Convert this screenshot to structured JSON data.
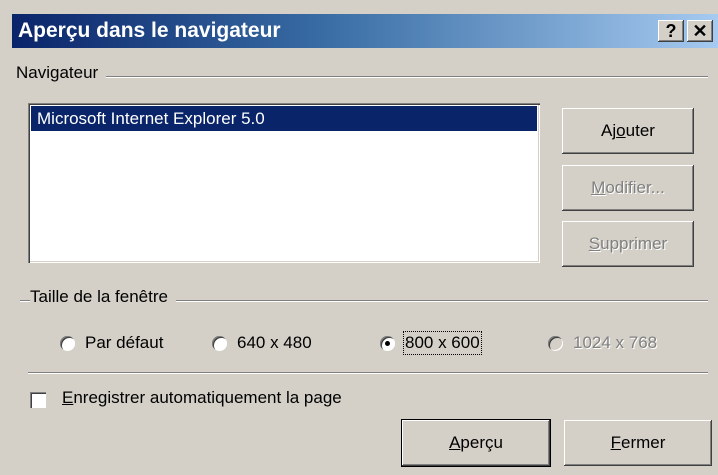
{
  "window": {
    "title": "Aperçu dans le navigateur",
    "help_glyph": "?",
    "close_glyph": "✕"
  },
  "browser_group": {
    "label": "Navigateur",
    "list_items": [
      {
        "label": "Microsoft Internet Explorer 5.0",
        "selected": true
      }
    ],
    "buttons": {
      "add": {
        "pre": "Aj",
        "mnemonic": "o",
        "post": "uter",
        "enabled": true
      },
      "modify": {
        "pre": "",
        "mnemonic": "M",
        "post": "odifier...",
        "enabled": false
      },
      "delete": {
        "pre": "",
        "mnemonic": "S",
        "post": "upprimer",
        "enabled": false
      }
    }
  },
  "window_size_group": {
    "label": "Taille de la fenêtre",
    "options": [
      {
        "label": "Par défaut",
        "selected": false,
        "enabled": true
      },
      {
        "label": "640 x 480",
        "selected": false,
        "enabled": true
      },
      {
        "label": "800 x 600",
        "selected": true,
        "enabled": true
      },
      {
        "label": "1024 x 768",
        "selected": false,
        "enabled": false
      }
    ]
  },
  "autosave": {
    "mnemonic": "E",
    "rest": "nregistrer automatiquement la page",
    "checked": false
  },
  "footer": {
    "preview": {
      "pre": "",
      "mnemonic": "A",
      "post": "perçu"
    },
    "close": {
      "pre": "",
      "mnemonic": "F",
      "post": "ermer"
    }
  },
  "colors": {
    "title_start": "#0a246a",
    "title_end": "#a6caf0",
    "selection": "#0a246a",
    "face": "#d4d0c8"
  }
}
